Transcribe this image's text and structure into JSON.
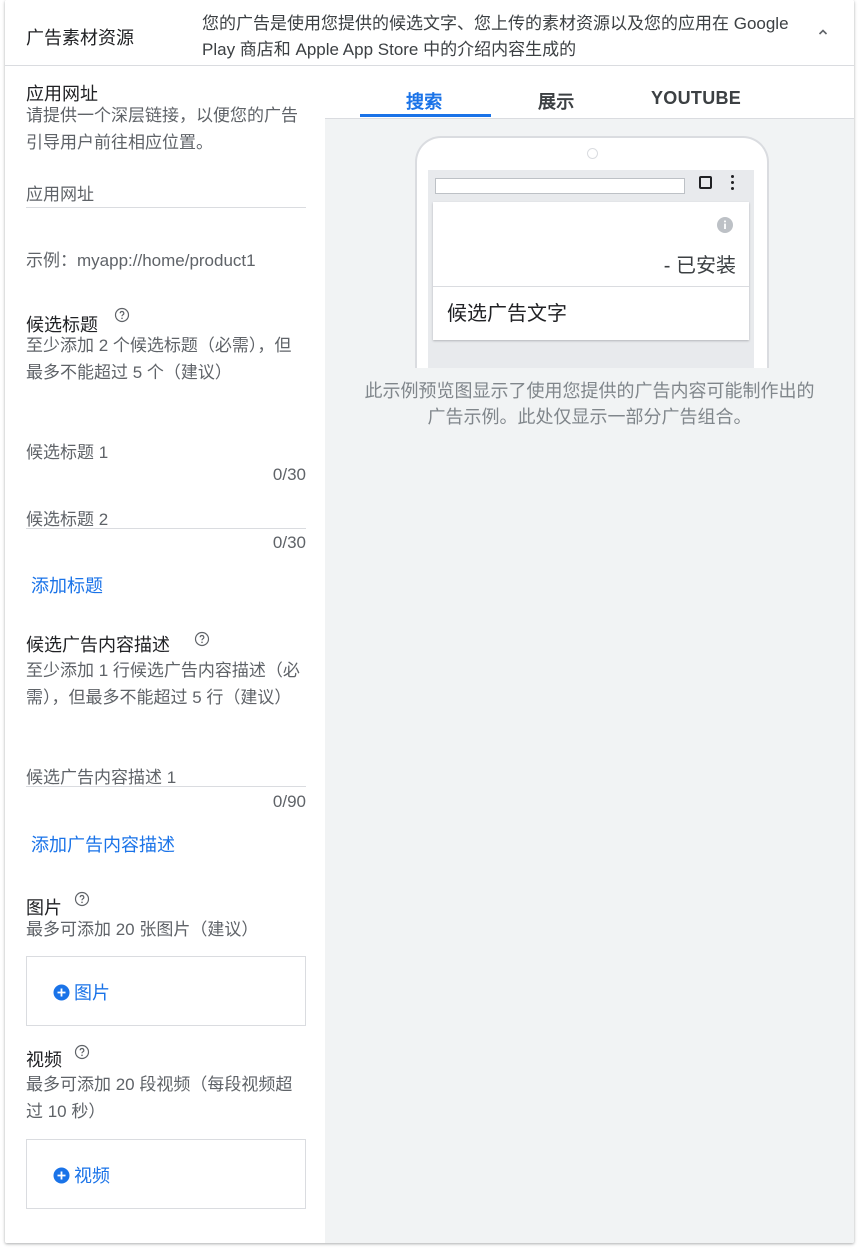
{
  "header": {
    "title": "广告素材资源",
    "description": "您的广告是使用您提供的候选文字、您上传的素材资源以及您的应用在 Google Play 商店和 Apple App Store 中的介绍内容生成的"
  },
  "app_url": {
    "label": "应用网址",
    "help": "请提供一个深层链接，以便您的广告引导用户前往相应位置。",
    "placeholder": "应用网址",
    "example": "示例：myapp://home/product1"
  },
  "headlines": {
    "label": "候选标题",
    "help": "至少添加 2 个候选标题（必需），但最多不能超过 5 个（建议）",
    "fields": [
      {
        "placeholder": "候选标题 1",
        "counter": "0/30"
      },
      {
        "placeholder": "候选标题 2",
        "counter": "0/30"
      }
    ],
    "add_link": "添加标题"
  },
  "descriptions": {
    "label": "候选广告内容描述",
    "help": "至少添加 1 行候选广告内容描述（必需），但最多不能超过 5 行（建议）",
    "fields": [
      {
        "placeholder": "候选广告内容描述 1",
        "counter": "0/90"
      }
    ],
    "add_link": "添加广告内容描述"
  },
  "images": {
    "label": "图片",
    "help": "最多可添加 20 张图片（建议）",
    "add_button": "图片"
  },
  "videos": {
    "label": "视频",
    "help": "最多可添加 20 段视频（每段视频超过 10 秒）",
    "add_button": "视频"
  },
  "preview": {
    "tabs": [
      "搜索",
      "展示",
      "YOUTUBE"
    ],
    "active_tab": "搜索",
    "ad": {
      "installed": "- 已安装",
      "ad_text": "候选广告文字"
    },
    "note": "此示例预览图显示了使用您提供的广告内容可能制作出的广告示例。此处仅显示一部分广告组合。"
  },
  "colors": {
    "accent": "#1a73e8",
    "panel_bg": "#f1f3f4",
    "text": "#202124",
    "secondary_text": "#5f6368"
  },
  "icons": {
    "chevron": "chevron-up-icon",
    "help": "help-circle-icon",
    "add": "add-circle-icon",
    "info": "info-icon"
  }
}
